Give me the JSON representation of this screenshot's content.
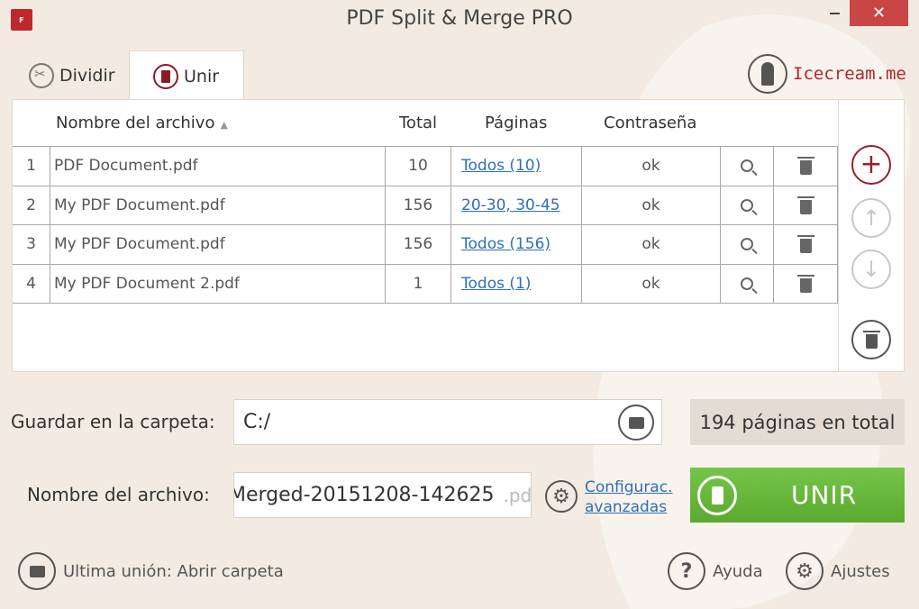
{
  "window": {
    "title": "PDF Split & Merge PRO",
    "app_icon_text": "ꜰ",
    "close_glyph": "✕"
  },
  "tabs": [
    {
      "label": "Dividir",
      "icon": "scissors-icon",
      "active": false
    },
    {
      "label": "Unir",
      "icon": "merge-icon",
      "active": true
    }
  ],
  "brand": {
    "label": "Icecream.me",
    "icon": "icecream-icon",
    "color": "#b3262e"
  },
  "table": {
    "headers": {
      "name": "Nombre del archivo",
      "total": "Total",
      "pages": "Páginas",
      "password": "Contraseña"
    },
    "sort_glyph": "▲",
    "rows": [
      {
        "num": "1",
        "name": "PDF Document.pdf",
        "total": "10",
        "pages": "Todos (10)",
        "password": "ok"
      },
      {
        "num": "2",
        "name": "My PDF Document.pdf",
        "total": "156",
        "pages": "20-30, 30-45",
        "password": "ok"
      },
      {
        "num": "3",
        "name": "My PDF Document.pdf",
        "total": "156",
        "pages": "Todos (156)",
        "password": "ok"
      },
      {
        "num": "4",
        "name": "My PDF Document 2.pdf",
        "total": "1",
        "pages": "Todos (1)",
        "password": "ok"
      }
    ]
  },
  "side_buttons": {
    "add_glyph": "+",
    "up_glyph": "↑",
    "down_glyph": "↓"
  },
  "form": {
    "folder_label": "Guardar en la carpeta:",
    "folder_value": "C:/",
    "filename_label": "Nombre del archivo:",
    "filename_value": "Merged-20151208-142625",
    "filename_ext": ".pdf",
    "advanced_line1": "Configurac.",
    "advanced_line2": "avanzadas",
    "gear_glyph": "⚙"
  },
  "summary": {
    "total_pages_text": "194 páginas en total"
  },
  "merge_button": {
    "label": "UNIR",
    "color": "#6bbb3c"
  },
  "footer": {
    "last_merge": "Ultima unión: Abrir carpeta",
    "help": "Ayuda",
    "help_glyph": "?",
    "settings": "Ajustes",
    "settings_glyph": "⚙"
  }
}
